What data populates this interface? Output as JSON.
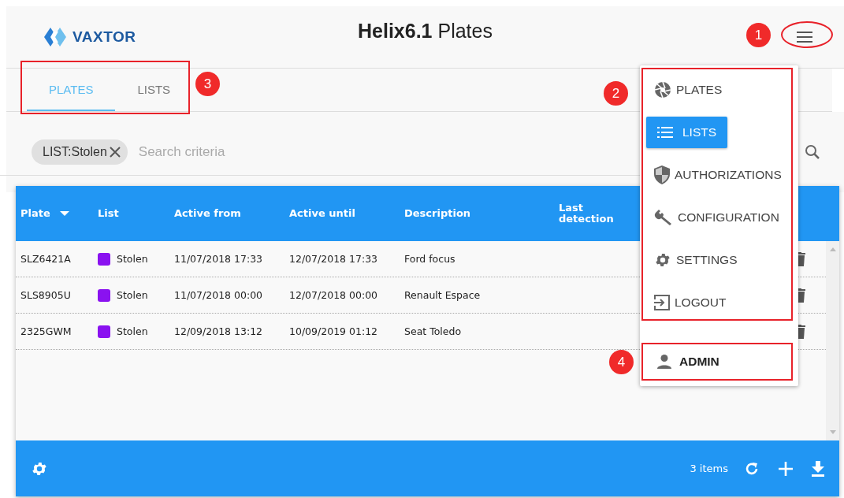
{
  "header": {
    "logo_text": "VAXTOR",
    "title": "**Helix6.1** Plates"
  },
  "tabs": [
    {
      "label": "PLATES",
      "selected": true
    },
    {
      "label": "LISTS",
      "selected": false
    }
  ],
  "search": {
    "chip": "LIST:Stolen",
    "placeholder": "Search criteria"
  },
  "table": {
    "columns": [
      {
        "label": "Plate",
        "sorted": true
      },
      {
        "label": "List",
        "sorted": false
      },
      {
        "label": "Active from",
        "sorted": false
      },
      {
        "label": "Active until",
        "sorted": false
      },
      {
        "label": "Description",
        "sorted": false
      },
      {
        "label": "Last detection",
        "sorted": false
      }
    ],
    "rows": [
      {
        "plate": "SLZ6421A",
        "list": "Stolen",
        "color": "#8a12f0",
        "active_from": "11/07/2018 17:33",
        "active_until": "12/07/2018 17:33",
        "description": "Ford focus"
      },
      {
        "plate": "SLS8905U",
        "list": "Stolen",
        "color": "#8a12f0",
        "active_from": "11/07/2018 00:00",
        "active_until": "12/07/2018 00:00",
        "description": "Renault Espace"
      },
      {
        "plate": "2325GWM",
        "list": "Stolen",
        "color": "#8a12f0",
        "active_from": "12/09/2018 13:12",
        "active_until": "10/09/2019 01:12",
        "description": "Seat Toledo"
      }
    ]
  },
  "footer": {
    "count": "3 items"
  },
  "menu": {
    "items": [
      {
        "label": "PLATES",
        "selected": false
      },
      {
        "label": "LISTS",
        "selected": true
      },
      {
        "label": "AUTHORIZATIONS",
        "selected": false
      },
      {
        "label": "CONFIGURATION",
        "selected": false
      },
      {
        "label": "SETTINGS",
        "selected": false
      },
      {
        "label": "LOGOUT",
        "selected": false
      }
    ],
    "user": "ADMIN"
  },
  "callouts": [
    "1",
    "2",
    "3",
    "4"
  ]
}
